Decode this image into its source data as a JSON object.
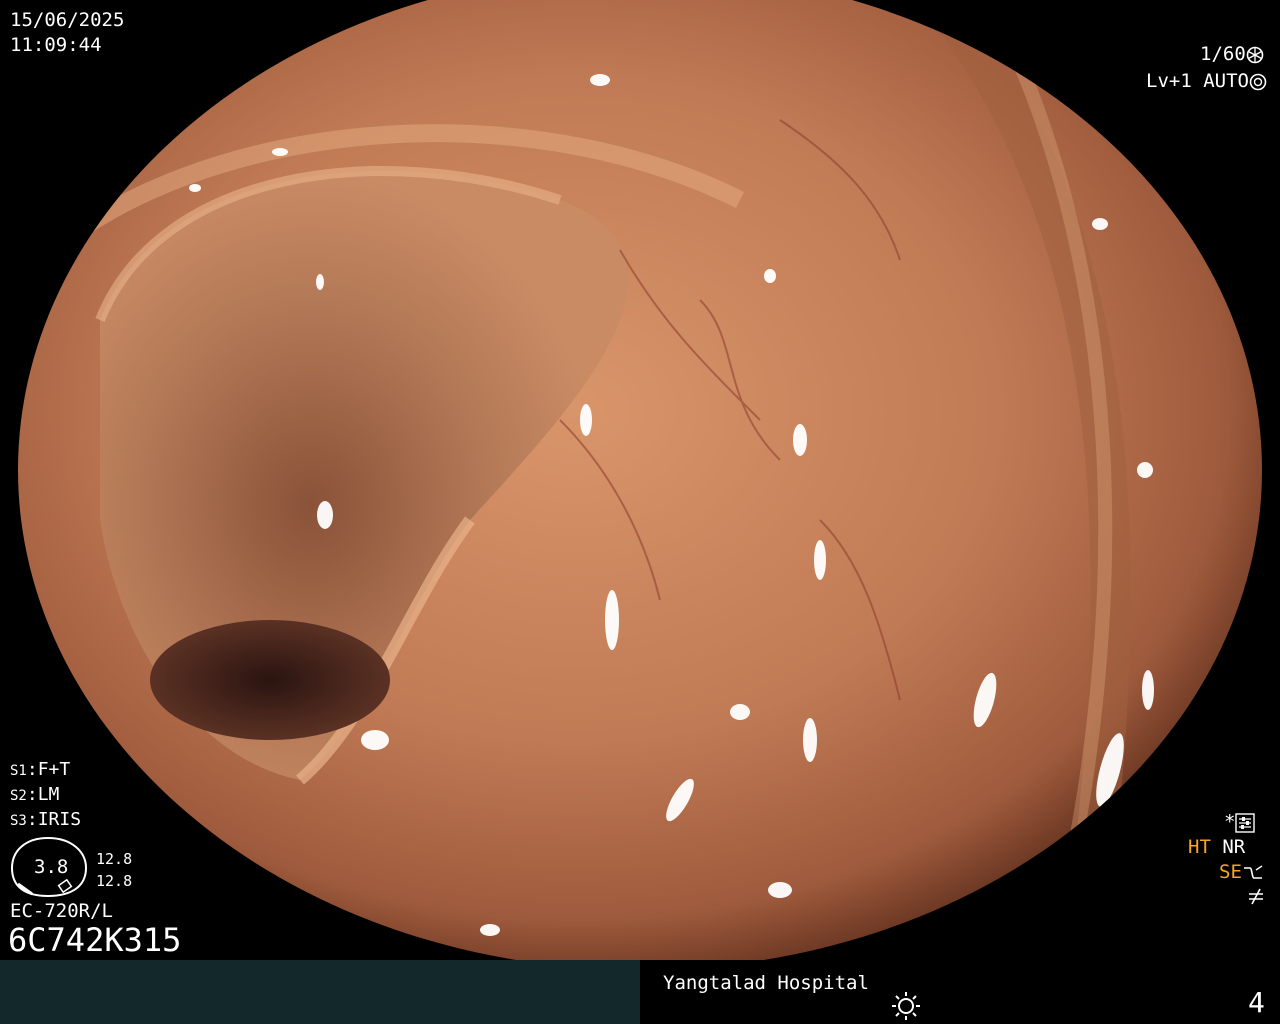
{
  "overlay": {
    "date": "15/06/2025",
    "time": "11:09:44",
    "shutter": "1/60",
    "level": "Lv+1",
    "mode": "AUTO",
    "presets": [
      {
        "key": "S1",
        "value": "F+T"
      },
      {
        "key": "S2",
        "value": "LM"
      },
      {
        "key": "S3",
        "value": "IRIS"
      }
    ],
    "gauge": {
      "value": "3.8",
      "top": "12.8",
      "bottom": "12.8"
    },
    "scope_model": "EC-720R/L",
    "serial": "6C742K315",
    "right_flags": {
      "asterisk": "*",
      "ht": "HT",
      "nr": "NR",
      "se": "SE"
    },
    "colors": {
      "accent_orange": "#f5a623",
      "bar": "#12282b"
    }
  },
  "footer": {
    "hospital": "Yangtalad Hospital",
    "page_number": "4",
    "icons": [
      "sun-icon"
    ]
  }
}
